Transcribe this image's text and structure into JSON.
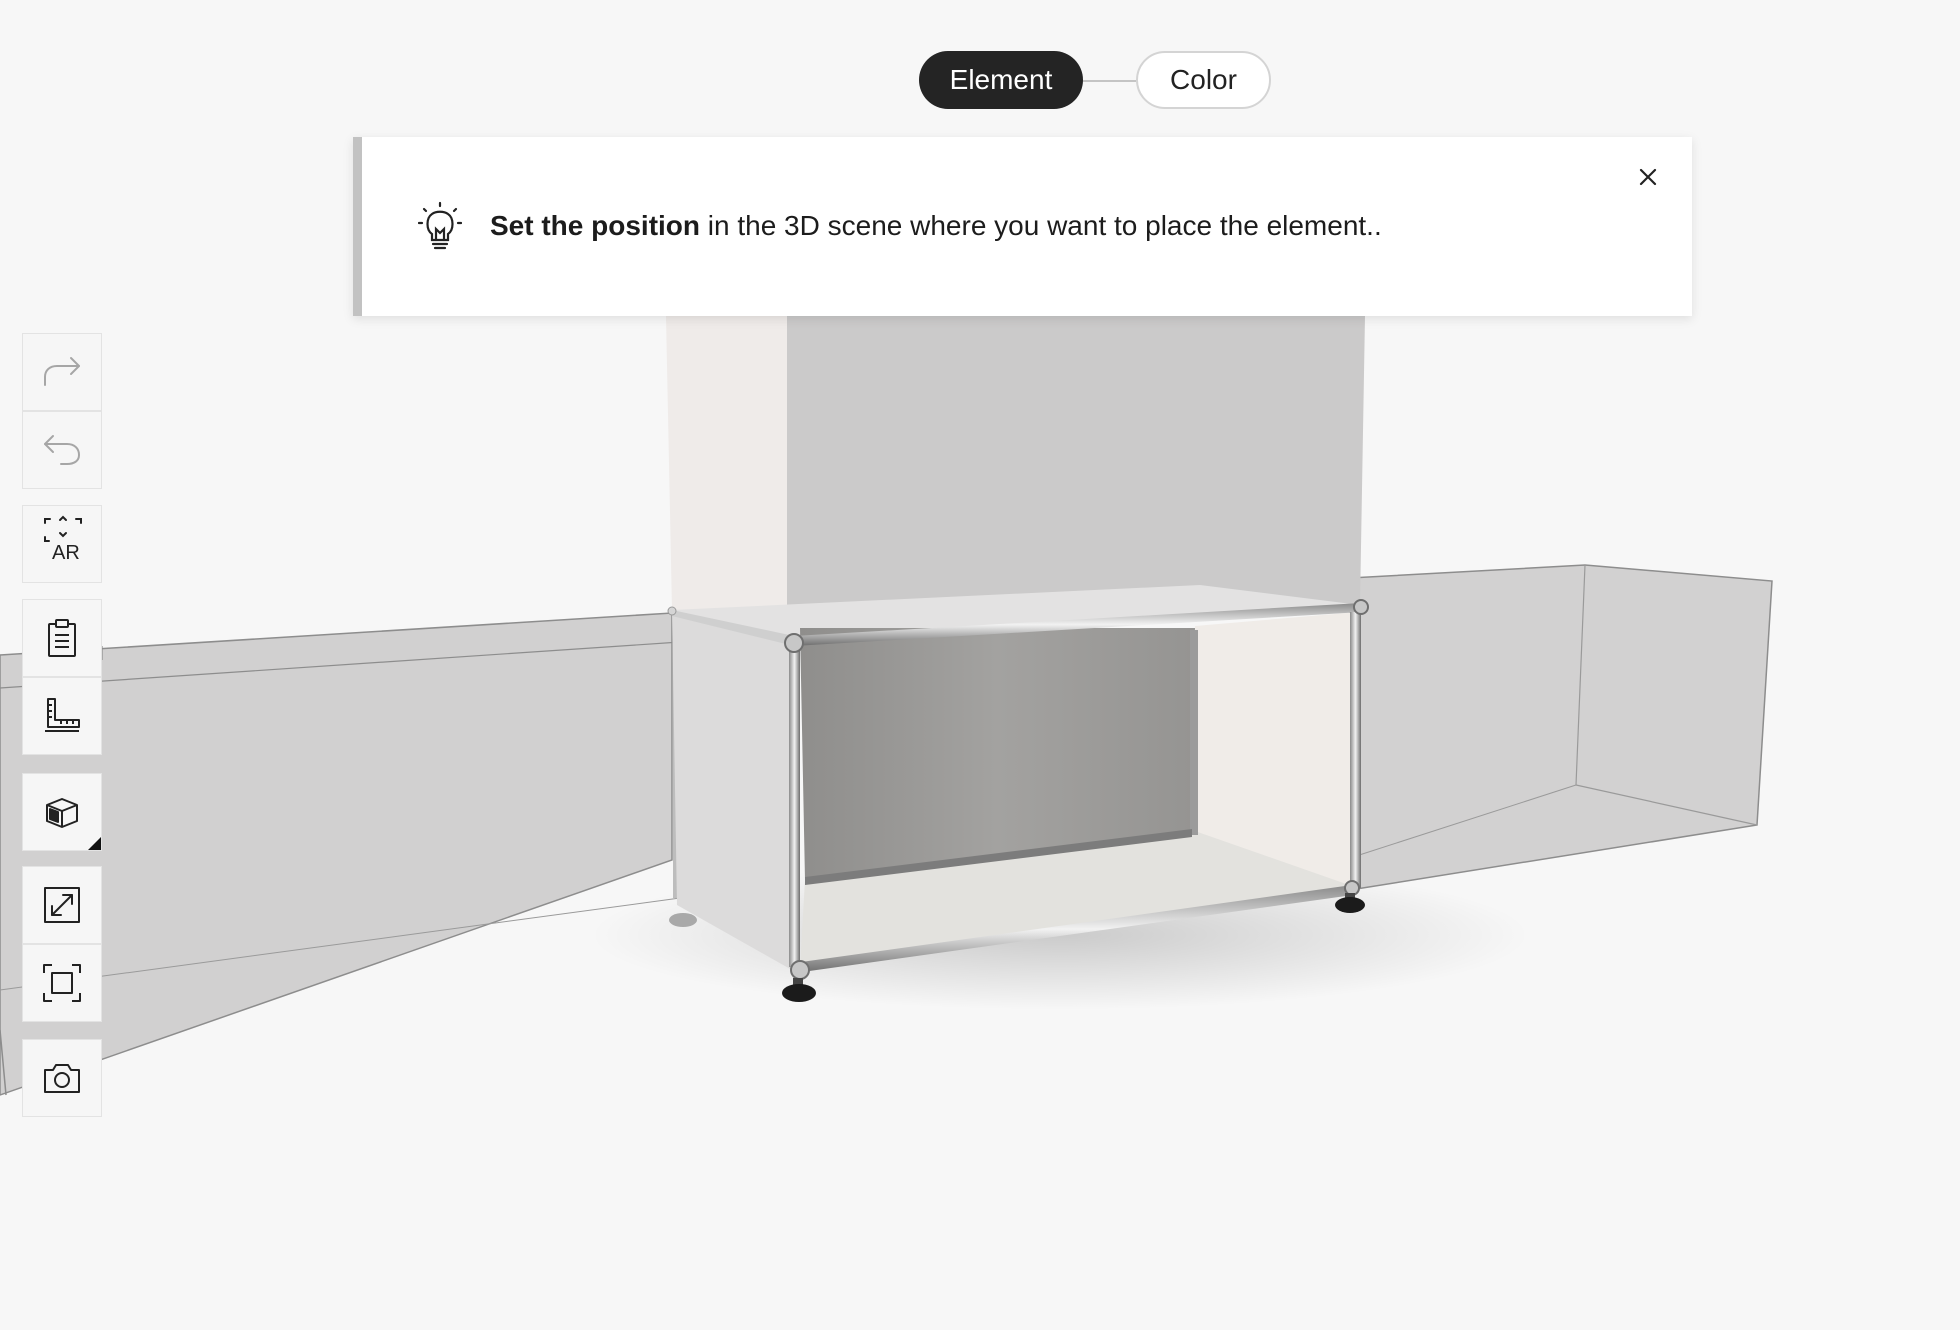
{
  "stepper": {
    "steps": [
      {
        "label": "Element",
        "active": true
      },
      {
        "label": "Color",
        "active": false
      }
    ]
  },
  "hint": {
    "bold_text": "Set the position",
    "text": " in the 3D scene where you want to place the element..",
    "icon": "lightbulb-icon",
    "close_icon": "close-icon"
  },
  "toolbar": {
    "items": [
      {
        "name": "redo",
        "icon": "redo-icon"
      },
      {
        "name": "undo",
        "icon": "undo-icon"
      },
      {
        "name": "ar",
        "icon": "ar-icon",
        "label": "AR"
      },
      {
        "name": "parts-list",
        "icon": "clipboard-icon"
      },
      {
        "name": "dimensions",
        "icon": "ruler-icon"
      },
      {
        "name": "view-mode",
        "icon": "cube-icon"
      },
      {
        "name": "expand",
        "icon": "expand-icon"
      },
      {
        "name": "fit-view",
        "icon": "fit-frame-icon"
      },
      {
        "name": "screenshot",
        "icon": "camera-icon"
      }
    ]
  },
  "colors": {
    "active_step": "#242424",
    "background": "#f7f7f7",
    "accent_border": "#c2c2c2"
  }
}
